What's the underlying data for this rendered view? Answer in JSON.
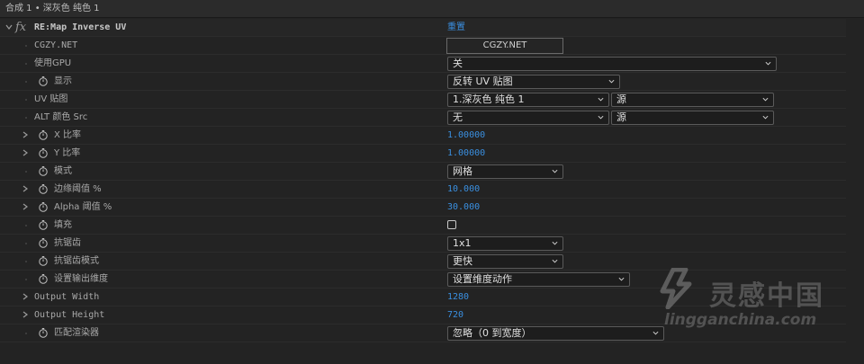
{
  "title": "合成 1 • 深灰色 纯色 1",
  "effect": {
    "fx_label": "fx",
    "name": "RE:Map Inverse UV",
    "reset_label": "重置"
  },
  "rows": {
    "cgzy": {
      "label": "CGZY.NET",
      "button": "CGZY.NET"
    },
    "gpu": {
      "label": "使用GPU",
      "value": "关"
    },
    "display": {
      "label": "显示",
      "value": "反转 UV 贴图"
    },
    "uvmap": {
      "label": "UV 贴图",
      "value": "1.深灰色 纯色 1",
      "value2": "源"
    },
    "altcolor": {
      "label": "ALT 颜色 Src",
      "value": "无",
      "value2": "源"
    },
    "xratio": {
      "label": "X 比率",
      "value": "1.00000"
    },
    "yratio": {
      "label": "Y 比率",
      "value": "1.00000"
    },
    "mode": {
      "label": "模式",
      "value": "网格"
    },
    "edge": {
      "label": "边缘阈值 %",
      "value": "10.000"
    },
    "alpha": {
      "label": "Alpha 阈值 %",
      "value": "30.000"
    },
    "fill": {
      "label": "填充",
      "checked": false
    },
    "antialias": {
      "label": "抗锯齿",
      "value": "1x1"
    },
    "aamode": {
      "label": "抗锯齿模式",
      "value": "更快"
    },
    "outdim": {
      "label": "设置输出维度",
      "value": "设置维度动作"
    },
    "outwidth": {
      "label": "Output Width",
      "value": "1280"
    },
    "outheight": {
      "label": "Output Height",
      "value": "720"
    },
    "renderer": {
      "label": "匹配渲染器",
      "value": "忽略（0 到宽度）"
    }
  },
  "watermark": {
    "cn": "灵感中国",
    "en": "lingganchina.com"
  },
  "colors": {
    "accent": "#3a8fe0",
    "background": "#232323"
  }
}
